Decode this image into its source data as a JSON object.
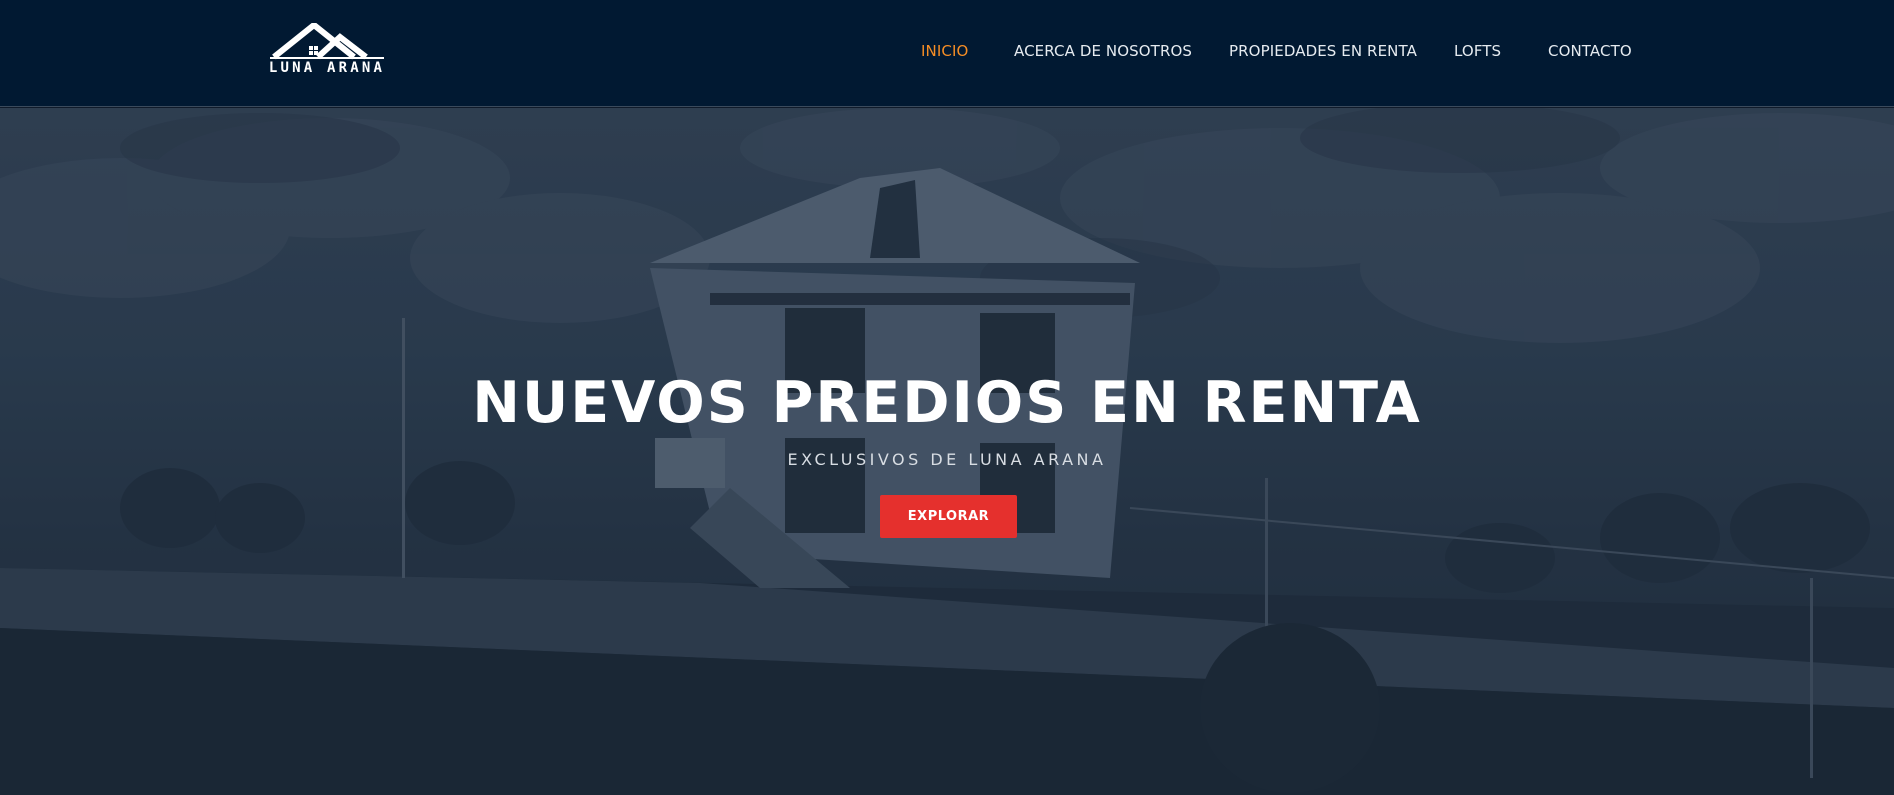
{
  "brand": {
    "name": "LUNA ARANA",
    "logo_icon": "house-roof-logo"
  },
  "nav": {
    "items": [
      {
        "label": "INICIO",
        "active": true
      },
      {
        "label": "ACERCA DE NOSOTROS",
        "active": false
      },
      {
        "label": "PROPIEDADES EN RENTA",
        "active": false
      },
      {
        "label": "LOFTS",
        "active": false
      },
      {
        "label": "CONTACTO",
        "active": false
      }
    ]
  },
  "hero": {
    "title": "NUEVOS PREDIOS EN RENTA",
    "subtitle": "EXCLUSIVOS DE LUNA ARANA",
    "cta_label": "EXPLORAR",
    "background_image": "house-photo"
  },
  "colors": {
    "navbar_bg": "#011932",
    "nav_active": "#f58d25",
    "cta_bg": "#e5302d",
    "text": "#ffffff"
  }
}
